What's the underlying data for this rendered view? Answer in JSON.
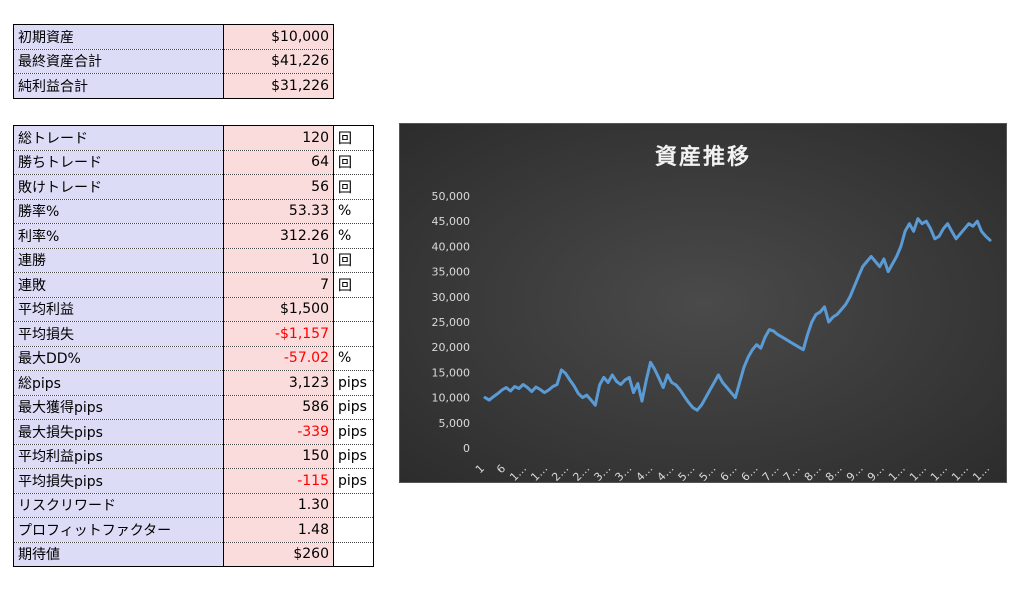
{
  "summary": [
    {
      "label": "初期資産",
      "value": "$10,000"
    },
    {
      "label": "最終資産合計",
      "value": "$41,226"
    },
    {
      "label": "純利益合計",
      "value": "$31,226"
    }
  ],
  "stats": [
    {
      "label": "総トレード",
      "value": "120",
      "unit": "回",
      "negative": false
    },
    {
      "label": "勝ちトレード",
      "value": "64",
      "unit": "回",
      "negative": false
    },
    {
      "label": "敗けトレード",
      "value": "56",
      "unit": "回",
      "negative": false
    },
    {
      "label": "勝率%",
      "value": "53.33",
      "unit": "%",
      "negative": false
    },
    {
      "label": "利率%",
      "value": "312.26",
      "unit": "%",
      "negative": false
    },
    {
      "label": "連勝",
      "value": "10",
      "unit": "回",
      "negative": false
    },
    {
      "label": "連敗",
      "value": "7",
      "unit": "回",
      "negative": false
    },
    {
      "label": "平均利益",
      "value": "$1,500",
      "unit": "",
      "negative": false
    },
    {
      "label": "平均損失",
      "value": "-$1,157",
      "unit": "",
      "negative": true
    },
    {
      "label": "最大DD%",
      "value": "-57.02",
      "unit": "%",
      "negative": true
    },
    {
      "label": "総pips",
      "value": "3,123",
      "unit": "pips",
      "negative": false
    },
    {
      "label": "最大獲得pips",
      "value": "586",
      "unit": "pips",
      "negative": false
    },
    {
      "label": "最大損失pips",
      "value": "-339",
      "unit": "pips",
      "negative": true
    },
    {
      "label": "平均利益pips",
      "value": "150",
      "unit": "pips",
      "negative": false
    },
    {
      "label": "平均損失pips",
      "value": "-115",
      "unit": "pips",
      "negative": true
    },
    {
      "label": "リスクリワード",
      "value": "1.30",
      "unit": "",
      "negative": false
    },
    {
      "label": "プロフィットファクター",
      "value": "1.48",
      "unit": "",
      "negative": false
    },
    {
      "label": "期待値",
      "value": "$260",
      "unit": "",
      "negative": false
    }
  ],
  "colors": {
    "label_bg": "#dcdcf6",
    "value_bg": "#fbdcdc",
    "negative_text": "#ff0000",
    "line": "#5b9bd5"
  },
  "chart_data": {
    "type": "line",
    "title": "資産推移",
    "ylim": [
      0,
      50000
    ],
    "yticks": [
      "0",
      "5,000",
      "10,000",
      "15,000",
      "20,000",
      "25,000",
      "30,000",
      "35,000",
      "40,000",
      "45,000",
      "50,000"
    ],
    "xtick_labels": [
      "1",
      "6",
      "1…",
      "1…",
      "2…",
      "2…",
      "3…",
      "3…",
      "4…",
      "4…",
      "5…",
      "5…",
      "6…",
      "6…",
      "7…",
      "7…",
      "8…",
      "8…",
      "9…",
      "9…",
      "1…",
      "1…",
      "1…",
      "1…",
      "1…"
    ],
    "grid": false,
    "series": [
      {
        "values": [
          10000,
          9500,
          10200,
          10800,
          11500,
          12000,
          11300,
          12200,
          11800,
          12600,
          12000,
          11200,
          12100,
          11600,
          11000,
          11500,
          12200,
          12600,
          15500,
          14800,
          13500,
          12300,
          10800,
          10000,
          10500,
          9500,
          8500,
          12500,
          14000,
          13000,
          14500,
          13200,
          12600,
          13500,
          14000,
          11000,
          12800,
          9300,
          13500,
          17000,
          15600,
          13800,
          12000,
          14500,
          13000,
          12500,
          11500,
          10200,
          9000,
          8000,
          7500,
          8500,
          10000,
          11500,
          13000,
          14500,
          13000,
          12000,
          11000,
          10000,
          13000,
          16000,
          18000,
          19500,
          20500,
          19800,
          22000,
          23500,
          23200,
          22500,
          22000,
          21500,
          21000,
          20500,
          20000,
          19500,
          22500,
          25000,
          26500,
          27000,
          28000,
          25000,
          26000,
          26500,
          27500,
          28500,
          30000,
          32000,
          34000,
          36000,
          37000,
          38000,
          37000,
          36000,
          37500,
          35000,
          36500,
          38000,
          40000,
          43000,
          44500,
          43000,
          45500,
          44500,
          45000,
          43500,
          41500,
          42000,
          43500,
          44500,
          43000,
          41500,
          42500,
          43500,
          44500,
          44000,
          45000,
          43000,
          42000,
          41226
        ]
      }
    ]
  }
}
